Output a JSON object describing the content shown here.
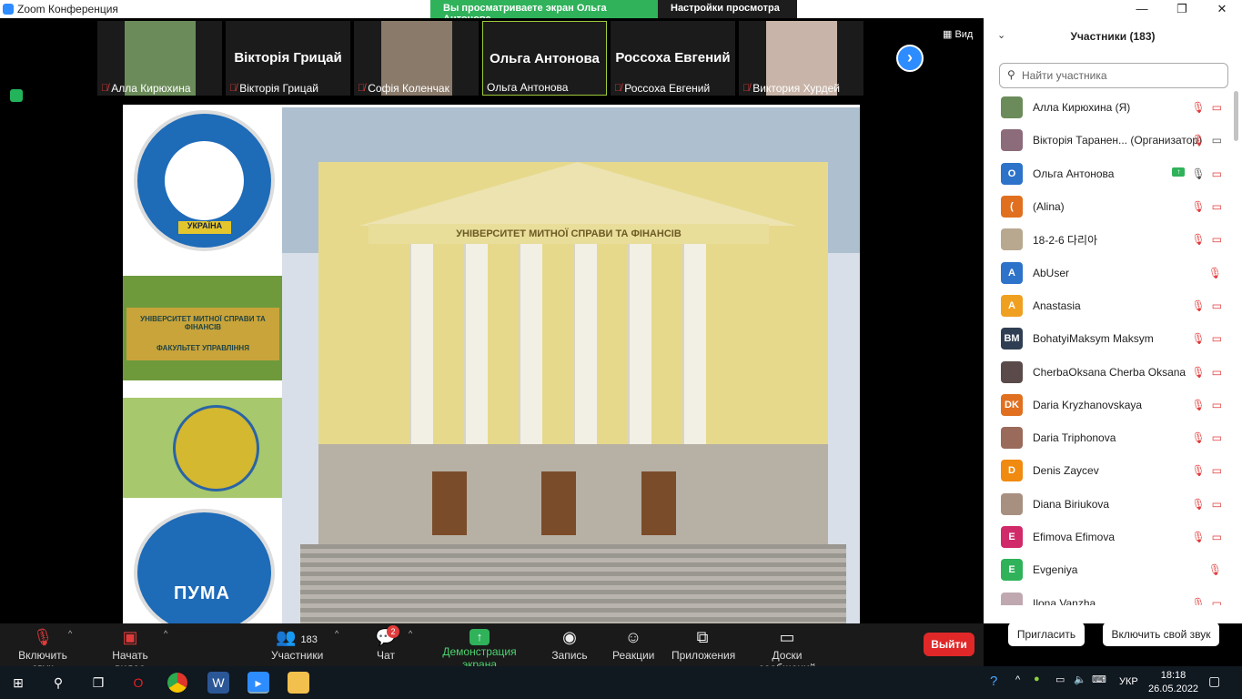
{
  "window": {
    "title": "Zoom Конференция",
    "controls": [
      "—",
      "❐",
      "✕"
    ]
  },
  "banner": {
    "viewing": "Вы просматриваете экран Ольга Антонова",
    "view_settings": "Настройки просмотра ⌄"
  },
  "view_button": "▦ Вид",
  "thumbnails": [
    {
      "name": "Алла Кирюхина",
      "type": "photo",
      "muted": true,
      "color": "#6b8c5a"
    },
    {
      "name": "Вікторія Грицай",
      "big": "Вікторія Грицай",
      "type": "text",
      "muted": true
    },
    {
      "name": "Софія Коленчак",
      "type": "photo",
      "muted": true,
      "color": "#8a7a6a"
    },
    {
      "name": "Ольга Антонова",
      "big": "Ольга Антонова",
      "type": "text",
      "muted": false,
      "active": true
    },
    {
      "name": "Россоха Евгений",
      "big": "Россоха Евгений",
      "type": "text",
      "muted": true
    },
    {
      "name": "Виктория Хурдей",
      "type": "photo",
      "muted": true,
      "color": "#c8b4a8"
    }
  ],
  "slide": {
    "seal_label": "УКРАЇНА",
    "sign_text": "УНІВЕРСИТЕТ МИТНОЇ СПРАВИ ТА ФІНАНСІВ",
    "sign_sub": "ФАКУЛЬТЕТ УПРАВЛІННЯ",
    "building_frieze": "УНІВЕРСИТЕТ МИТНОЇ СПРАВИ ТА ФІНАНСІВ",
    "puma": "ПУМА"
  },
  "participants_panel": {
    "title": "Участники (183)",
    "search_placeholder": "Найти участника",
    "items": [
      {
        "name": "Алла Кирюхина (Я)",
        "avatar": "",
        "avatar_color": "#6b8c5a",
        "mic": "off",
        "video": "off"
      },
      {
        "name": "Вікторія Таранен... (Организатор)",
        "avatar": "",
        "avatar_color": "#8c6b7a",
        "mic": "off",
        "video": "on"
      },
      {
        "name": "Ольга Антонова",
        "avatar": "О",
        "avatar_color": "#2d73c9",
        "mic": "on",
        "video": "off",
        "sharing": true
      },
      {
        "name": "(Alina)",
        "avatar": "(",
        "avatar_color": "#e07020",
        "mic": "off",
        "video": "off"
      },
      {
        "name": "18-2-6 다리아",
        "avatar": "",
        "avatar_color": "#b8a890",
        "mic": "off",
        "video": "off"
      },
      {
        "name": "AbUser",
        "avatar": "A",
        "avatar_color": "#2d73c9",
        "mic": "off",
        "video": "none"
      },
      {
        "name": "Anastasia",
        "avatar": "A",
        "avatar_color": "#f0a020",
        "mic": "off",
        "video": "off"
      },
      {
        "name": "BohatyiMaksym Maksym",
        "avatar": "BM",
        "avatar_color": "#2f3e52",
        "mic": "off",
        "video": "off"
      },
      {
        "name": "CherbaOksana Cherba Oksana",
        "avatar": "",
        "avatar_color": "#5a4a4a",
        "mic": "off",
        "video": "off"
      },
      {
        "name": "Daria Kryzhanovskaya",
        "avatar": "DK",
        "avatar_color": "#e07020",
        "mic": "off",
        "video": "off"
      },
      {
        "name": "Daria Triphonova",
        "avatar": "",
        "avatar_color": "#9a6a5a",
        "mic": "off",
        "video": "off"
      },
      {
        "name": "Denis Zaycev",
        "avatar": "D",
        "avatar_color": "#f08a10",
        "mic": "off",
        "video": "off"
      },
      {
        "name": "Diana Biriukova",
        "avatar": "",
        "avatar_color": "#a89080",
        "mic": "off",
        "video": "off"
      },
      {
        "name": "Efimova Efimova",
        "avatar": "E",
        "avatar_color": "#d02a6a",
        "mic": "off",
        "video": "off"
      },
      {
        "name": "Evgeniya",
        "avatar": "E",
        "avatar_color": "#2fb25a",
        "mic": "off",
        "video": "none"
      },
      {
        "name": "Ilona Vanzha",
        "avatar": "",
        "avatar_color": "#c0a8b0",
        "mic": "off",
        "video": "off"
      }
    ],
    "invite": "Пригласить",
    "unmute_self": "Включить свой звук"
  },
  "toolbar": {
    "unmute": "Включить звук",
    "start_video": "Начать видео",
    "participants": "Участники",
    "participants_count": "183",
    "chat": "Чат",
    "chat_badge": "2",
    "share_screen": "Демонстрация экрана",
    "record": "Запись",
    "reactions": "Реакции",
    "apps": "Приложения",
    "whiteboards": "Доски сообщений",
    "leave": "Выйти"
  },
  "taskbar": {
    "lang": "УКР",
    "time": "18:18",
    "date": "26.05.2022"
  }
}
